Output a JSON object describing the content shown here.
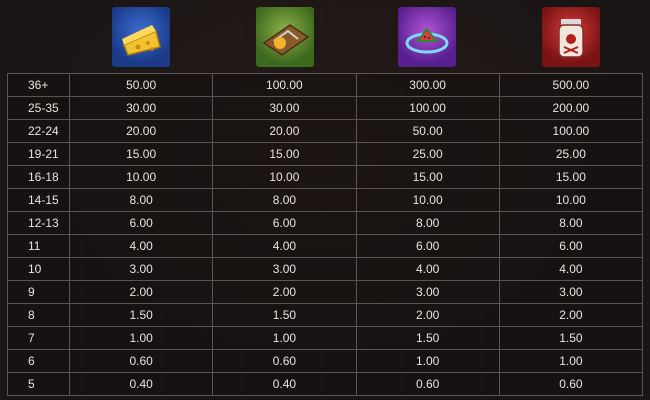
{
  "symbols": [
    {
      "name": "cheese-icon",
      "bg": "#2f5fc0"
    },
    {
      "name": "mousetrap-icon",
      "bg": "#6a9a34"
    },
    {
      "name": "watermelon-trap-icon",
      "bg": "#8e3fc4"
    },
    {
      "name": "poison-jar-icon",
      "bg": "#c02828"
    }
  ],
  "paytable": {
    "rows": [
      {
        "count": "36+",
        "values": [
          "50.00",
          "100.00",
          "300.00",
          "500.00"
        ]
      },
      {
        "count": "25-35",
        "values": [
          "30.00",
          "30.00",
          "100.00",
          "200.00"
        ]
      },
      {
        "count": "22-24",
        "values": [
          "20.00",
          "20.00",
          "50.00",
          "100.00"
        ]
      },
      {
        "count": "19-21",
        "values": [
          "15.00",
          "15.00",
          "25.00",
          "25.00"
        ]
      },
      {
        "count": "16-18",
        "values": [
          "10.00",
          "10.00",
          "15.00",
          "15.00"
        ]
      },
      {
        "count": "14-15",
        "values": [
          "8.00",
          "8.00",
          "10.00",
          "10.00"
        ]
      },
      {
        "count": "12-13",
        "values": [
          "6.00",
          "6.00",
          "8.00",
          "8.00"
        ]
      },
      {
        "count": "11",
        "values": [
          "4.00",
          "4.00",
          "6.00",
          "6.00"
        ]
      },
      {
        "count": "10",
        "values": [
          "3.00",
          "3.00",
          "4.00",
          "4.00"
        ]
      },
      {
        "count": "9",
        "values": [
          "2.00",
          "2.00",
          "3.00",
          "3.00"
        ]
      },
      {
        "count": "8",
        "values": [
          "1.50",
          "1.50",
          "2.00",
          "2.00"
        ]
      },
      {
        "count": "7",
        "values": [
          "1.00",
          "1.00",
          "1.50",
          "1.50"
        ]
      },
      {
        "count": "6",
        "values": [
          "0.60",
          "0.60",
          "1.00",
          "1.00"
        ]
      },
      {
        "count": "5",
        "values": [
          "0.40",
          "0.40",
          "0.60",
          "0.60"
        ]
      }
    ]
  }
}
